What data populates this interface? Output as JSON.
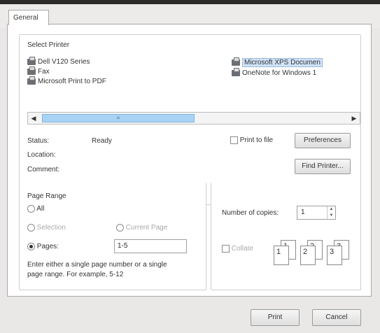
{
  "tabs": [
    {
      "label": "General"
    }
  ],
  "select_printer": {
    "label": "Select Printer",
    "printers": [
      {
        "name": "Dell V120 Series",
        "selected": false
      },
      {
        "name": "Fax",
        "selected": false
      },
      {
        "name": "Microsoft Print to PDF",
        "selected": false
      },
      {
        "name": "Microsoft XPS Documen",
        "selected": true
      },
      {
        "name": "OneNote for Windows 1",
        "selected": false
      }
    ]
  },
  "status": {
    "label": "Status:",
    "value": "Ready"
  },
  "location": {
    "label": "Location:",
    "value": ""
  },
  "comment": {
    "label": "Comment:",
    "value": ""
  },
  "print_to_file": {
    "label": "Print to file",
    "checked": false
  },
  "buttons": {
    "preferences": "Preferences",
    "find_printer": "Find Printer...",
    "print": "Print",
    "cancel": "Cancel"
  },
  "page_range": {
    "label": "Page Range",
    "all": "All",
    "selection": "Selection",
    "current_page": "Current Page",
    "pages": "Pages:",
    "pages_value": "1-5",
    "selected": "pages",
    "help_line1": "Enter either a single page number or a single",
    "help_line2": "page range.  For example, 5-12"
  },
  "copies": {
    "label": "Number of copies:",
    "value": "1",
    "collate_label": "Collate",
    "collate_checked": false
  },
  "collate_pages": [
    {
      "big": "1",
      "small": "1"
    },
    {
      "big": "2",
      "small": "2"
    },
    {
      "big": "3",
      "small": "3"
    }
  ]
}
